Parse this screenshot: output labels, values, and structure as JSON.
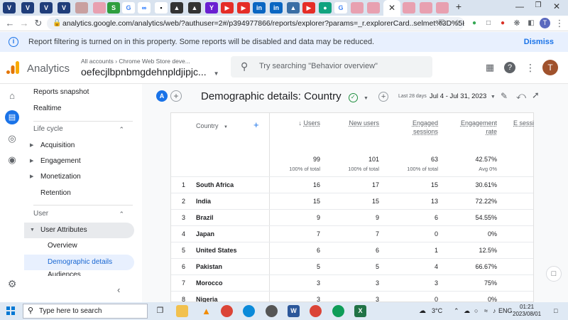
{
  "browser": {
    "tabs": [
      "V",
      "V",
      "V",
      "V",
      "img",
      "S",
      "G",
      "∞",
      "▪",
      "▲",
      "▲",
      "Y",
      "▶",
      "▶",
      "in",
      "in",
      "▲",
      "▶",
      "●",
      "G",
      "img",
      "img",
      "img",
      "img"
    ],
    "active_tab_close": "✕",
    "new_tab": "+",
    "url": "analytics.google.com/analytics/web/?authuser=2#/p394977866/reports/explorer?params=_r.explorerCard..selmet%3D%5B\"activeUse...",
    "back": "←",
    "forward": "→",
    "reload": "↻"
  },
  "banner": {
    "message": "Report filtering is turned on in this property. Some reports will be disabled and data may be reduced.",
    "dismiss_label": "Dismiss"
  },
  "header": {
    "app_name": "Analytics",
    "breadcrumb": "All accounts › Chrome Web Store deve...",
    "property": "oefecjlbpnbmgdehnpldjipjc...",
    "search_placeholder": "Try searching \"Behavior overview\"",
    "avatar_initial": "T"
  },
  "sidebar": {
    "top_items": [
      "Reports snapshot",
      "Realtime"
    ],
    "life_cycle": {
      "label": "Life cycle",
      "items": [
        "Acquisition",
        "Engagement",
        "Monetization",
        "Retention"
      ]
    },
    "user": {
      "label": "User",
      "group": "User Attributes",
      "items": [
        "Overview",
        "Demographic details",
        "Audiences"
      ]
    }
  },
  "report": {
    "compare_badge": "A",
    "title": "Demographic details: Country",
    "date_label": "Last 28 days",
    "date_range": "Jul 4 - Jul 31, 2023"
  },
  "table": {
    "dimension_header": "Country",
    "metric_headers": [
      "Users",
      "New users",
      "Engaged sessions",
      "Engagement rate",
      "E sessi"
    ],
    "totals": [
      "99",
      "101",
      "63",
      "42.57%"
    ],
    "totals_sub": [
      "100% of total",
      "100% of total",
      "100% of total",
      "Avg 0%"
    ],
    "rows": [
      {
        "rank": "1",
        "country": "South Africa",
        "users": "16",
        "new_users": "17",
        "engaged": "15",
        "rate": "30.61%"
      },
      {
        "rank": "2",
        "country": "India",
        "users": "15",
        "new_users": "15",
        "engaged": "13",
        "rate": "72.22%"
      },
      {
        "rank": "3",
        "country": "Brazil",
        "users": "9",
        "new_users": "9",
        "engaged": "6",
        "rate": "54.55%"
      },
      {
        "rank": "4",
        "country": "Japan",
        "users": "7",
        "new_users": "7",
        "engaged": "0",
        "rate": "0%"
      },
      {
        "rank": "5",
        "country": "United States",
        "users": "6",
        "new_users": "6",
        "engaged": "1",
        "rate": "12.5%"
      },
      {
        "rank": "6",
        "country": "Pakistan",
        "users": "5",
        "new_users": "5",
        "engaged": "4",
        "rate": "66.67%"
      },
      {
        "rank": "7",
        "country": "Morocco",
        "users": "3",
        "new_users": "3",
        "engaged": "3",
        "rate": "75%"
      },
      {
        "rank": "8",
        "country": "Nigeria",
        "users": "3",
        "new_users": "3",
        "engaged": "0",
        "rate": "0%"
      }
    ]
  },
  "taskbar": {
    "search_placeholder": "Type here to search",
    "weather": "3°C",
    "language": "ENG",
    "time": "01:21",
    "date": "2023/08/01"
  },
  "colors": {
    "accent": "#1a73e8",
    "banner_bg": "#e8f0fe",
    "logo_orange": "#f9ab00",
    "logo_dark": "#e37400"
  }
}
